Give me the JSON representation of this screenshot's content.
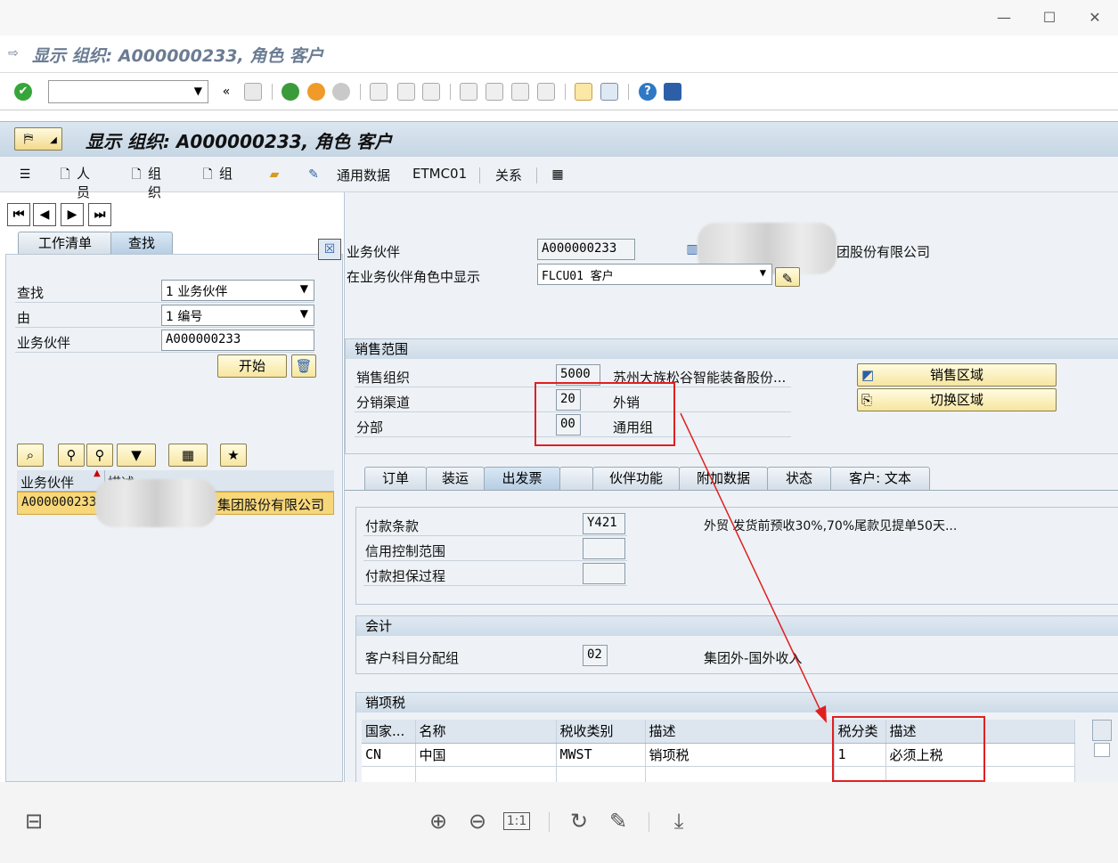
{
  "window": {
    "minimize": "—",
    "maximize": "☐",
    "close": "✕"
  },
  "title": "显示 组织: A000000233, 角色 客户",
  "header_title": "显示 组织: A000000233, 角色 客户",
  "menu": {
    "person": "人员",
    "org": "组织",
    "group": "组",
    "general_data": "通用数据",
    "etmc": "ETMC01",
    "relations": "关系"
  },
  "left": {
    "tabs": [
      "工作清单",
      "查找"
    ],
    "find_label": "查找",
    "find_value": "1 业务伙伴",
    "by_label": "由",
    "by_value": "1 编号",
    "bp_label": "业务伙伴",
    "bp_value": "A000000233",
    "start_button": "开始",
    "list_headers": [
      "业务伙伴",
      "描述"
    ],
    "list_row": {
      "bp": "A000000233",
      "desc": "集团股份有限公司"
    }
  },
  "right": {
    "bp_label": "业务伙伴",
    "bp_value": "A000000233",
    "company_name": "团股份有限公司",
    "role_label": "在业务伙伴角色中显示",
    "role_value": "FLCU01 客户",
    "sales_area": {
      "title": "销售范围",
      "org_label": "销售组织",
      "org_value": "5000",
      "org_desc": "苏州大族松谷智能装备股份...",
      "channel_label": "分销渠道",
      "channel_value": "20",
      "channel_desc": "外销",
      "division_label": "分部",
      "division_value": "00",
      "division_desc": "通用组",
      "sales_area_button": "销售区域",
      "switch_area_button": "切换区域"
    },
    "tabs": [
      "订单",
      "装运",
      "出发票",
      "",
      "伙伴功能",
      "附加数据",
      "状态",
      "客户: 文本"
    ],
    "payment": {
      "terms_label": "付款条款",
      "terms_value": "Y421",
      "terms_desc": "外贸 发货前预收30%,70%尾款见提单50天...",
      "credit_label": "信用控制范围",
      "credit_value": "",
      "guarantee_label": "付款担保过程",
      "guarantee_value": ""
    },
    "accounting": {
      "title": "会计",
      "group_label": "客户科目分配组",
      "group_value": "02",
      "group_desc": "集团外-国外收入"
    },
    "tax": {
      "title": "销项税",
      "headers": [
        "国家...",
        "名称",
        "税收类别",
        "描述",
        "税分类",
        "描述"
      ],
      "rows": [
        [
          "CN",
          "中国",
          "MWST",
          "销项税",
          "1",
          "必须上税"
        ]
      ]
    }
  },
  "colors": {
    "highlight_red": "#e02020",
    "row_selected": "#f7d77a",
    "button_yellow": "#f7e6a0"
  }
}
